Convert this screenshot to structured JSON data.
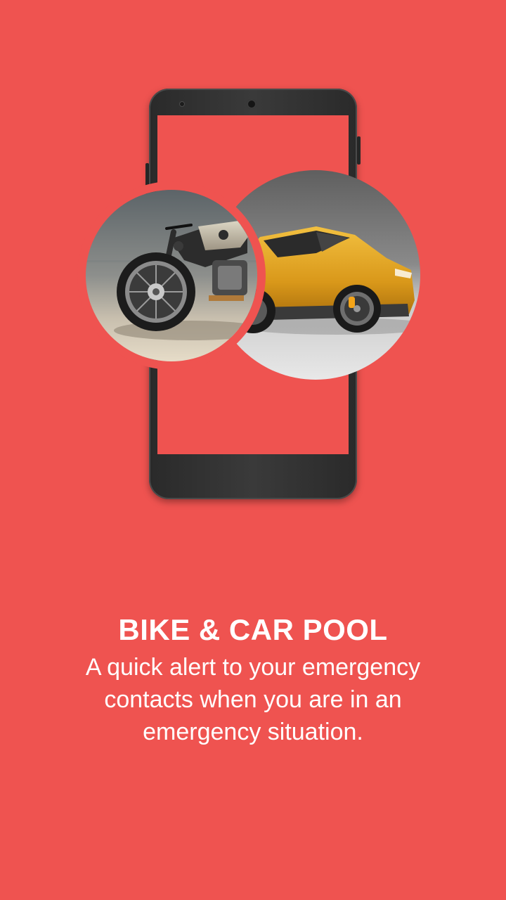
{
  "colors": {
    "background": "#EF5350",
    "phone_body": "#2f2f2f",
    "text": "#FFFFFF",
    "car_body": "#E2A521",
    "brake_caliper": "#F4A418"
  },
  "onboarding": {
    "title": "BIKE & CAR POOL",
    "description": "A quick alert to your emergency contacts when you are in an emergency situation."
  },
  "illustration": {
    "phone_icon": "phone-mockup-icon",
    "images": [
      "motorcycle-image",
      "yellow-car-image"
    ]
  }
}
